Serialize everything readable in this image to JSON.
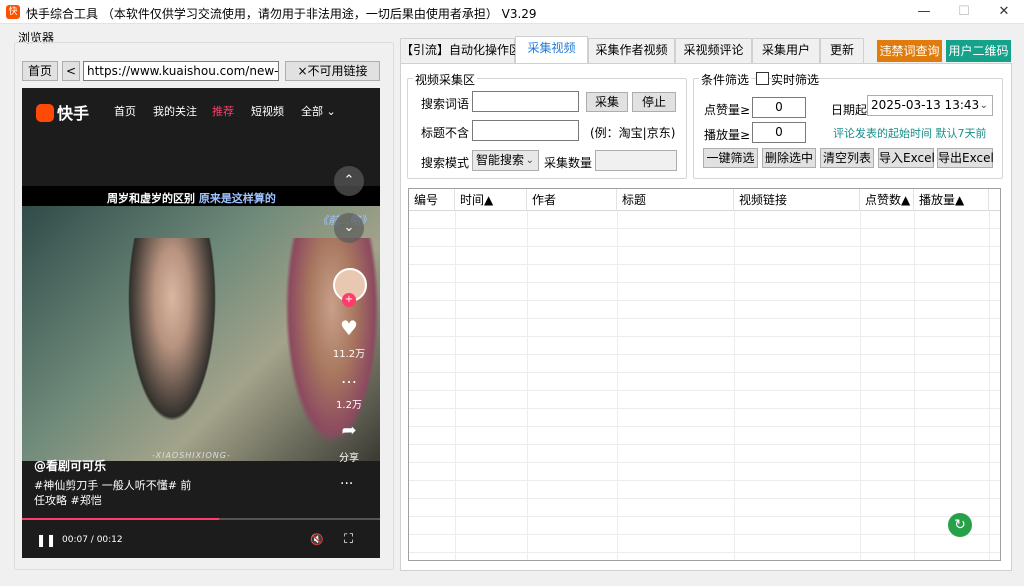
{
  "window": {
    "app_icon_glyph": "快",
    "title": "快手综合工具  （本软件仅供学习交流使用，请勿用于非法用途，一切后果由使用者承担）  V3.29",
    "minimize_glyph": "—",
    "maximize_glyph": "☐",
    "close_glyph": "✕"
  },
  "browser": {
    "label": "浏览器",
    "home_button": "首页",
    "back_button": "<",
    "url": "https://www.kuaishou.com/new-reco",
    "unavailable_button": "×不可用链接"
  },
  "kuaishou": {
    "logo": "快手",
    "nav": [
      "首页",
      "我的关注",
      "推荐",
      "短视频",
      "全部 ⌄"
    ],
    "active_nav_color": "#ff3c6a",
    "video_caption_plain": "周岁和虚岁的区别",
    "video_caption_highlight": "原来是这样算的",
    "video_overlay_text": "《前...略》",
    "up_glyph": "⌃",
    "down_glyph": "⌄",
    "avatar_plus": "+",
    "like_icon": "♥",
    "like_count": "11.2万",
    "comment_icon": "…",
    "comment_count": "1.2万",
    "share_icon": "➦",
    "share_label": "分享",
    "subtitle_strip": "-XIAOSHIXIONG-",
    "author": "@看剧可可乐",
    "description": "#神仙剪刀手 一般人听不懂# 前任攻略 #郑恺",
    "more_glyph": "···",
    "progress": 0.55,
    "play_glyph": "❚❚",
    "time": "00:07 / 00:12",
    "mute_glyph": "🔇",
    "fullscreen_glyph": "⛶"
  },
  "tabs": [
    {
      "label": "【引流】自动化操作区"
    },
    {
      "label": "采集视频"
    },
    {
      "label": "采集作者视频"
    },
    {
      "label": "采视频评论"
    },
    {
      "label": "采集用户"
    },
    {
      "label": "更新"
    }
  ],
  "top_buttons": {
    "banned_words": "违禁词查询",
    "qr_code": "用户二维码"
  },
  "collect_group": {
    "title": "视频采集区",
    "keyword_label": "搜索词语",
    "keyword_value": "",
    "collect_button": "采集",
    "stop_button": "停止",
    "exclude_label": "标题不含",
    "exclude_value": "",
    "exclude_example": "(例：淘宝|京东)",
    "mode_label": "搜索模式",
    "mode_value": "智能搜索",
    "count_label": "采集数量",
    "count_value": ""
  },
  "filter_group": {
    "title": "条件筛选",
    "realtime_label": "实时筛选",
    "likes_label": "点赞量≥",
    "likes_value": "0",
    "plays_label": "播放量≥",
    "plays_value": "0",
    "date_label": "日期起",
    "date_value": "2025-03-13 13:43",
    "hint": "评论发表的起始时间 默认7天前",
    "buttons": [
      "一键筛选",
      "删除选中",
      "清空列表",
      "导入Excel",
      "导出Excel"
    ]
  },
  "table": {
    "columns": [
      "编号",
      "时间▲",
      "作者",
      "标题",
      "视频链接",
      "点赞数▲",
      "播放量▲"
    ]
  },
  "refresh_icon": "↻",
  "colors": {
    "orange_button": "#e07b0e",
    "teal_button": "#14a28a",
    "active_tab_text": "#1f7ad8",
    "hint_text": "#1a8f8a",
    "refresh": "#27a04a"
  }
}
